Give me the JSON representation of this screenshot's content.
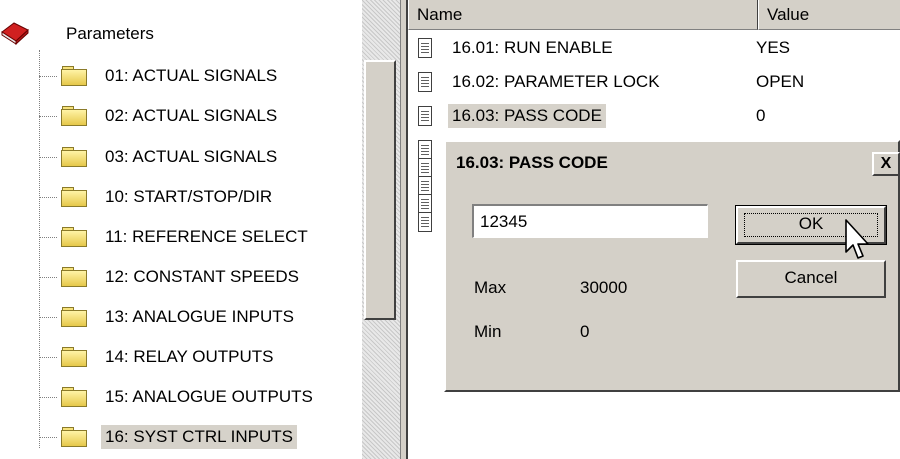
{
  "tree": {
    "root_label": "Parameters",
    "items": [
      {
        "label": "01: ACTUAL SIGNALS"
      },
      {
        "label": "02: ACTUAL SIGNALS"
      },
      {
        "label": "03: ACTUAL SIGNALS"
      },
      {
        "label": "10: START/STOP/DIR"
      },
      {
        "label": "11: REFERENCE SELECT"
      },
      {
        "label": "12: CONSTANT SPEEDS"
      },
      {
        "label": "13: ANALOGUE INPUTS"
      },
      {
        "label": "14: RELAY OUTPUTS"
      },
      {
        "label": "15: ANALOGUE OUTPUTS"
      },
      {
        "label": "16: SYST CTRL INPUTS",
        "selected": true
      }
    ]
  },
  "list": {
    "columns": [
      "Name",
      "Value"
    ],
    "rows": [
      {
        "name": "16.01: RUN ENABLE",
        "value": "YES"
      },
      {
        "name": "16.02: PARAMETER LOCK",
        "value": "OPEN"
      },
      {
        "name": "16.03: PASS CODE",
        "value": "0",
        "selected": true
      }
    ]
  },
  "dialog": {
    "title": "16.03: PASS CODE",
    "close_symbol": "X",
    "input_value": "12345",
    "ok_label": "OK",
    "cancel_label": "Cancel",
    "max_label": "Max",
    "max_value": "30000",
    "min_label": "Min",
    "min_value": "0"
  }
}
